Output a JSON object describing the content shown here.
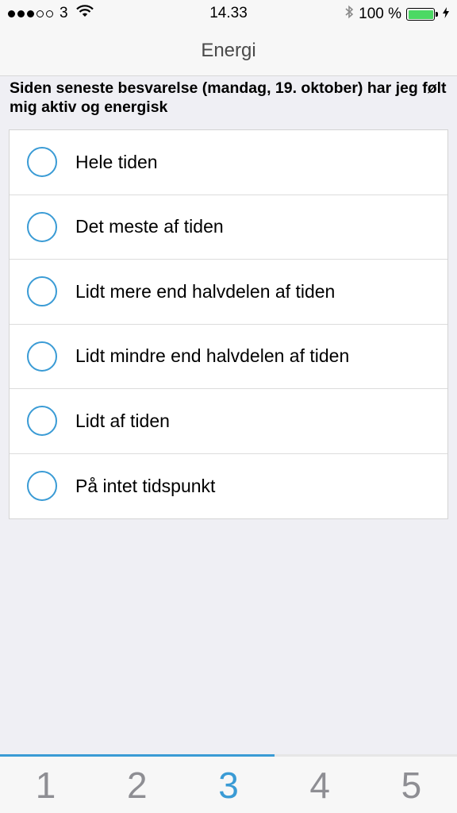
{
  "status_bar": {
    "carrier": "3",
    "signal_icon": "signal-dots-icon",
    "wifi_icon": "wifi-icon",
    "time": "14.33",
    "bluetooth_icon": "bluetooth-icon",
    "battery_percent": "100 %",
    "battery_level": 1.0,
    "charging_icon": "charging-bolt-icon",
    "battery_color": "#4cd964"
  },
  "nav": {
    "title": "Energi"
  },
  "question": {
    "text": "Siden seneste besvarelse (mandag, 19. oktober) har jeg følt mig aktiv og energisk"
  },
  "options": [
    {
      "label": "Hele tiden",
      "selected": false
    },
    {
      "label": "Det meste af tiden",
      "selected": false
    },
    {
      "label": "Lidt mere end halvdelen af tiden",
      "selected": false
    },
    {
      "label": "Lidt mindre end halvdelen af tiden",
      "selected": false
    },
    {
      "label": "Lidt af tiden",
      "selected": false
    },
    {
      "label": "På intet tidspunkt",
      "selected": false
    }
  ],
  "tab_bar": {
    "tabs": [
      "1",
      "2",
      "3",
      "4",
      "5"
    ],
    "active_tab": "3",
    "progress": 0.6,
    "accent_color": "#3a9bd5"
  }
}
